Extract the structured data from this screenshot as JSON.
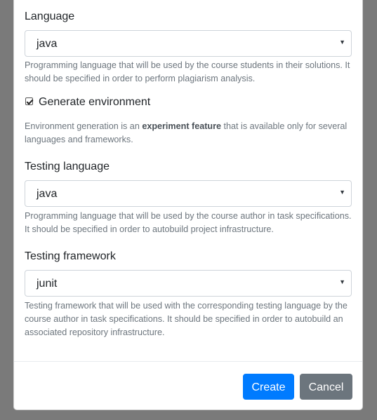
{
  "form": {
    "language": {
      "label": "Language",
      "value": "java",
      "help": "Programming language that will be used by the course students in their solutions. It should be specified in order to perform plagiarism analysis."
    },
    "generate_env": {
      "label": "Generate environment",
      "checked": true,
      "help_prefix": "Environment generation is an ",
      "help_bold": "experiment feature",
      "help_suffix": " that is available only for several languages and frameworks."
    },
    "testing_language": {
      "label": "Testing language",
      "value": "java",
      "help": "Programming language that will be used by the course author in task specifications. It should be specified in order to autobuild project infrastructure."
    },
    "testing_framework": {
      "label": "Testing framework",
      "value": "junit",
      "help": "Testing framework that will be used with the corresponding testing language by the course author in task specifications. It should be specified in order to autobuild an associated repository infrastructure."
    }
  },
  "footer": {
    "create_label": "Create",
    "cancel_label": "Cancel"
  },
  "colors": {
    "primary": "#007bff",
    "secondary": "#6c757d",
    "overlay": "#7a7a7a"
  },
  "icons": {
    "select_caret": "caret-down-icon",
    "checkbox": "checkbox-checked-icon"
  }
}
